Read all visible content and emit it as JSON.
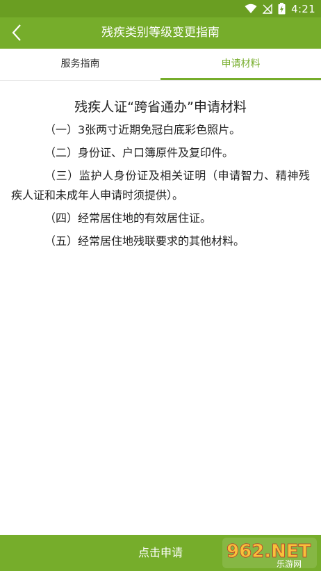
{
  "status_bar": {
    "time": "4:21",
    "icons": [
      "wifi-icon",
      "no-signal-icon",
      "battery-charging-icon"
    ]
  },
  "app_bar": {
    "back_icon": "chevron-left-icon",
    "title": "残疾类别等级变更指南"
  },
  "tabs": [
    {
      "label": "服务指南",
      "active": false
    },
    {
      "label": "申请材料",
      "active": true
    }
  ],
  "content": {
    "title": "残疾人证“跨省通办”申请材料",
    "items": [
      "（一）3张两寸近期免冠白底彩色照片。",
      "（二）身份证、户口簿原件及复印件。",
      "（三）监护人身份证及相关证明（申请智力、精神残疾人证和未成年人申请时须提供）。",
      "（四）经常居住地的有效居住证。",
      "（五）经常居住地残联要求的其他材料。"
    ]
  },
  "bottom": {
    "apply_label": "点击申请"
  },
  "watermark": {
    "text": "962.NET",
    "subtext": "乐游网"
  },
  "colors": {
    "status_bar": "#6a9e22",
    "primary": "#76ad2b",
    "text": "#222222"
  }
}
